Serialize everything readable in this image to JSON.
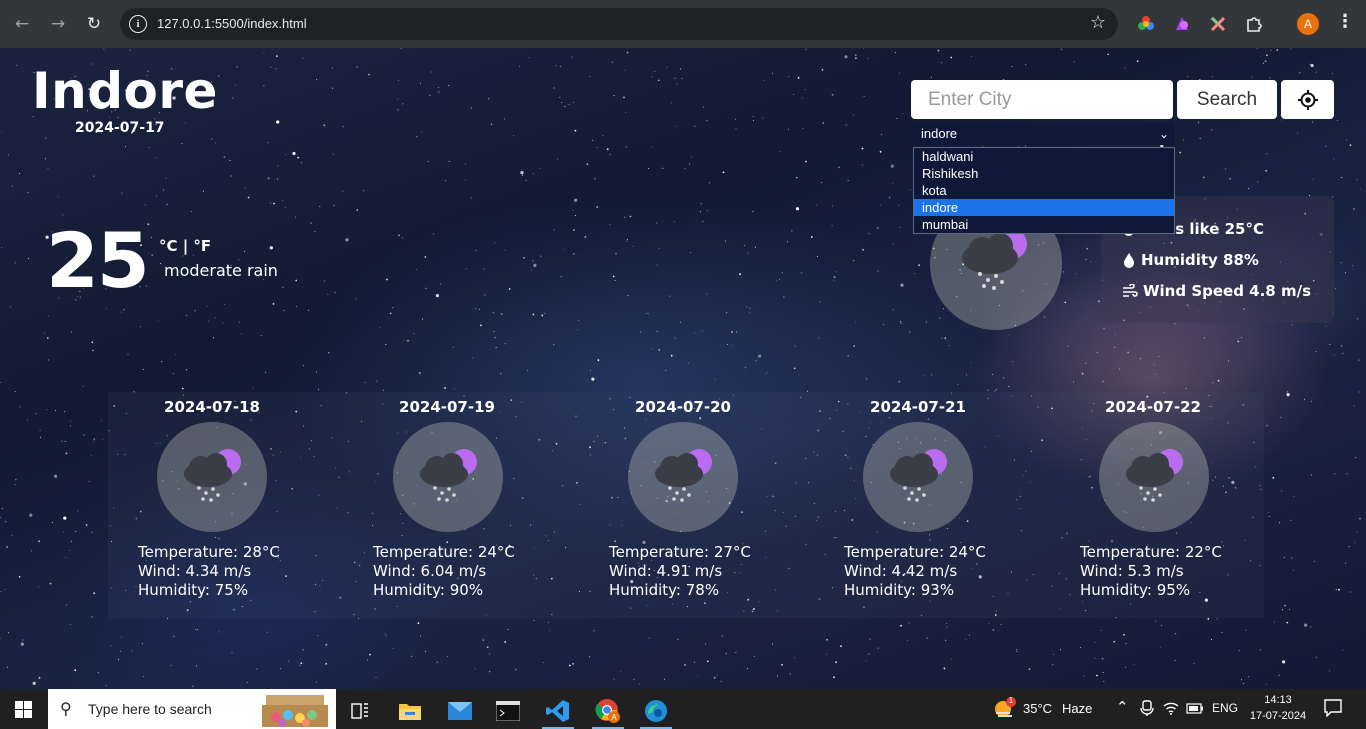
{
  "browser": {
    "url": "127.0.0.1:5500/index.html",
    "avatar_letter": "A"
  },
  "weather": {
    "city": "Indore",
    "date": "2024-07-17",
    "temperature": "25",
    "units": "°C | °F",
    "description": "moderate rain",
    "feels_like": "Feels like 25°C",
    "humidity": "Humidity 88%",
    "wind_speed": "Wind Speed 4.8 m/s"
  },
  "search": {
    "placeholder": "Enter City",
    "button_label": "Search"
  },
  "city_select": {
    "selected": "indore",
    "options": [
      "haldwani",
      "Rishikesh",
      "kota",
      "indore",
      "mumbai"
    ]
  },
  "forecast": [
    {
      "date": "2024-07-18",
      "temperature": "Temperature: 28°C",
      "wind": "Wind: 4.34 m/s",
      "humidity": "Humidity: 75%"
    },
    {
      "date": "2024-07-19",
      "temperature": "Temperature: 24°C",
      "wind": "Wind: 6.04 m/s",
      "humidity": "Humidity: 90%"
    },
    {
      "date": "2024-07-20",
      "temperature": "Temperature: 27°C",
      "wind": "Wind: 4.91 m/s",
      "humidity": "Humidity: 78%"
    },
    {
      "date": "2024-07-21",
      "temperature": "Temperature: 24°C",
      "wind": "Wind: 4.42 m/s",
      "humidity": "Humidity: 93%"
    },
    {
      "date": "2024-07-22",
      "temperature": "Temperature: 22°C",
      "wind": "Wind: 5.3 m/s",
      "humidity": "Humidity: 95%"
    }
  ],
  "taskbar": {
    "search_placeholder": "Type here to search",
    "weather_temp": "35°C",
    "weather_text": "Haze",
    "language": "ENG",
    "time": "14:13",
    "date": "17-07-2024",
    "weather_badge": "1"
  },
  "colors": {
    "accent_blue": "#1a73e8",
    "dropdown_bg": "#0f1839",
    "taskbar_bg": "#202020",
    "chrome_bg": "#35363a"
  }
}
